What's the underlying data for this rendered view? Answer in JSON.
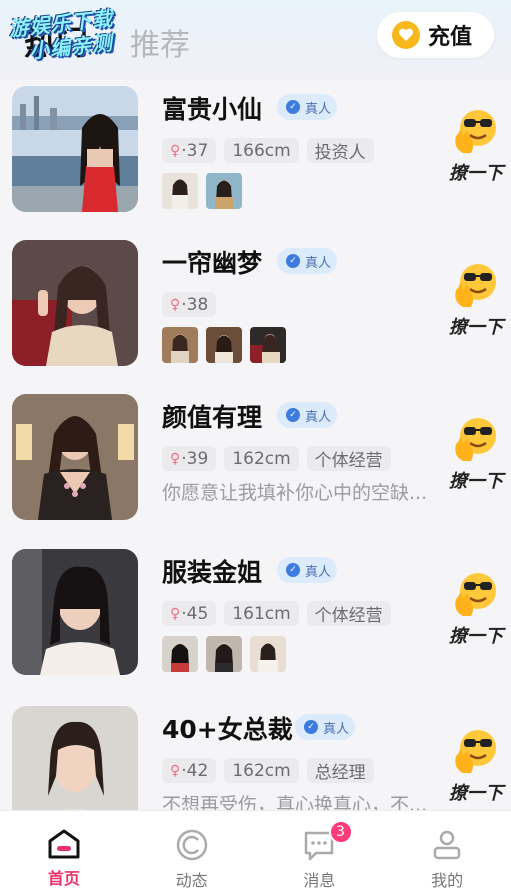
{
  "header": {
    "tab_hot": "热门",
    "tab_recommend": "推荐",
    "watermark_line1": "游娱乐下载",
    "watermark_line2": "小编亲测",
    "recharge_label": "充值"
  },
  "wave_label": "撩一下",
  "verified_label": "真人",
  "profiles": [
    {
      "name": "富贵小仙",
      "age": "·37",
      "height": "166cm",
      "occupation": "投资人",
      "photos": 2,
      "bio": ""
    },
    {
      "name": "一帘幽梦",
      "age": "·38",
      "height": "",
      "occupation": "",
      "photos": 3,
      "bio": ""
    },
    {
      "name": "颜值有理",
      "age": "·39",
      "height": "162cm",
      "occupation": "个体经营",
      "photos": 0,
      "bio": "你愿意让我填补你心中的空缺..."
    },
    {
      "name": "服装金姐",
      "age": "·45",
      "height": "161cm",
      "occupation": "个体经营",
      "photos": 3,
      "bio": ""
    },
    {
      "name": "40+女总裁",
      "age": "·42",
      "height": "162cm",
      "occupation": "总经理",
      "photos": 0,
      "bio": "不想再受伤，真心换真心，不..."
    }
  ],
  "bottom_nav": {
    "home": "首页",
    "moments": "动态",
    "messages": "消息",
    "messages_badge": "3",
    "mine": "我的"
  },
  "colors": {
    "accent": "#e8336c",
    "verify_bg": "#dcebfb",
    "verify_text": "#4a6fb3",
    "coin": "#f7b81c",
    "badge": "#ff3c79"
  },
  "icons": {
    "recharge": "heart-coin-icon",
    "wave": "sunglasses-emoji-hand-icon",
    "verified": "check-badge-icon",
    "female": "female-icon",
    "home": "home-icon",
    "moments": "moments-circle-icon",
    "messages": "chat-bubble-icon",
    "mine": "person-icon"
  }
}
